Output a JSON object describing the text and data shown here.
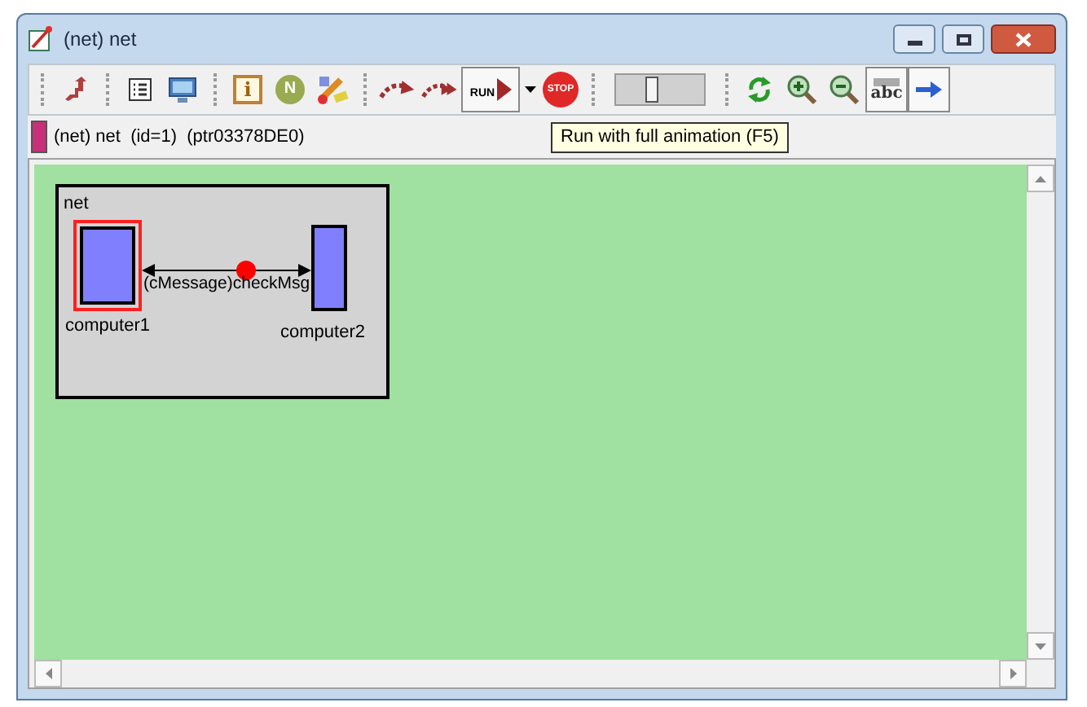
{
  "window": {
    "title": "(net) net"
  },
  "toolbar": [
    {
      "kind": "sep"
    },
    {
      "kind": "raise",
      "pressed": false
    },
    {
      "kind": "sep"
    },
    {
      "kind": "list",
      "pressed": false
    },
    {
      "kind": "monitor",
      "pressed": false
    },
    {
      "kind": "sep"
    },
    {
      "kind": "info",
      "label": "i",
      "pressed": false
    },
    {
      "kind": "n",
      "label": "N",
      "pressed": false
    },
    {
      "kind": "tool",
      "pressed": false
    },
    {
      "kind": "sep"
    },
    {
      "kind": "step",
      "pressed": false
    },
    {
      "kind": "fast",
      "pressed": false
    },
    {
      "kind": "run",
      "label": "RUN",
      "pressed": true
    },
    {
      "kind": "menu",
      "pressed": false
    },
    {
      "kind": "stop",
      "label": "STOP",
      "pressed": false
    },
    {
      "kind": "sep"
    },
    {
      "kind": "slider",
      "level": 0.4
    },
    {
      "kind": "sep"
    },
    {
      "kind": "refresh",
      "pressed": false
    },
    {
      "kind": "zoom-in",
      "pressed": false
    },
    {
      "kind": "zoom-out",
      "pressed": false
    },
    {
      "kind": "labels",
      "label": "abc",
      "pressed": true
    },
    {
      "kind": "arrow",
      "pressed": true
    }
  ],
  "info_bar": {
    "color": "#c8307a",
    "text": "(net) net  (id=1)  (ptr03378DE0)"
  },
  "tooltip": "Run with full animation (F5)",
  "diagram": {
    "module": "net",
    "submodules": [
      {
        "name": "computer1",
        "selected": true
      },
      {
        "name": "computer2",
        "selected": false
      }
    ],
    "message": "(cMessage)checkMsg"
  }
}
